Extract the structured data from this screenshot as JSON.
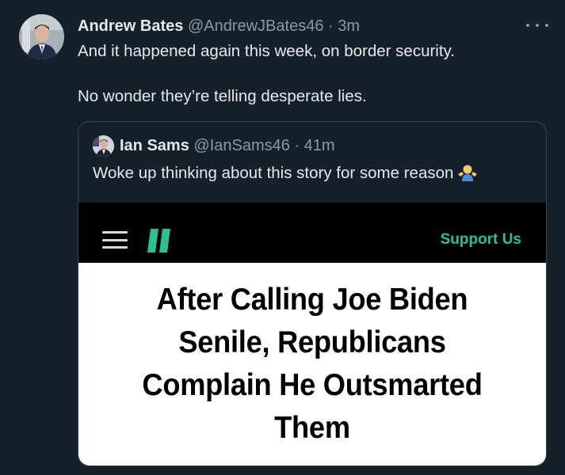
{
  "tweet": {
    "author": {
      "name": "Andrew Bates",
      "handle": "@AndrewJBates46",
      "separator": "·",
      "time": "3m"
    },
    "text_line1": "And it happened again this week, on border security.",
    "text_line2": "No wonder they’re telling desperate lies.",
    "more_icon": "more-horizontal-icon"
  },
  "quote": {
    "author": {
      "name": "Ian Sams",
      "handle": "@IanSams46",
      "separator": "·",
      "time": "41m"
    },
    "text": "Woke up thinking about this story for some reason",
    "emoji": "person-shrugging-emoji"
  },
  "article": {
    "menu_icon": "hamburger-menu-icon",
    "logo_icon": "huffpost-logo-icon",
    "support_label": "Support Us",
    "headline_lines": [
      "After Calling Joe Biden",
      "Senile, Republicans",
      "Complain He Outsmarted",
      "Them"
    ],
    "accent_color": "#29c193"
  },
  "colors": {
    "background": "#15202b",
    "text_primary": "#e7e9ea",
    "text_secondary": "#8b98a5",
    "border": "#38444d"
  }
}
